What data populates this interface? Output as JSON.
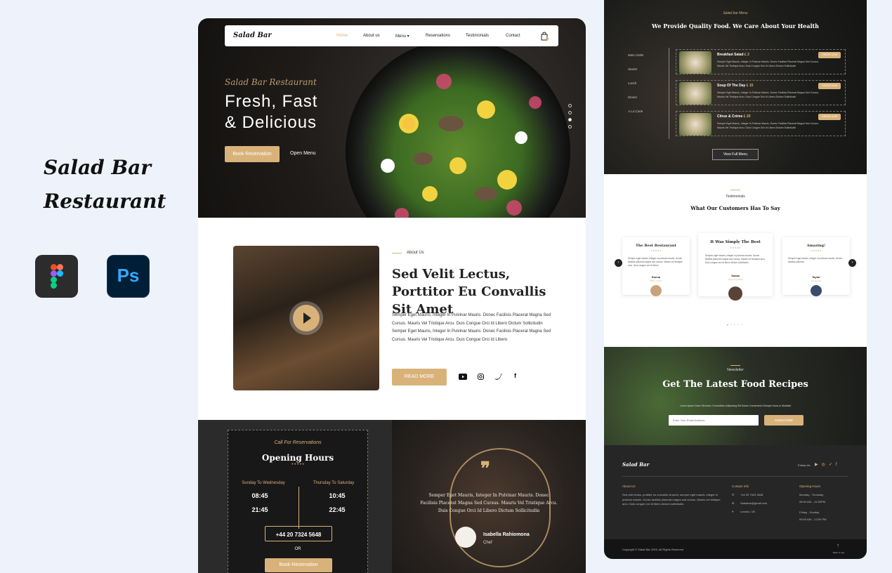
{
  "promo": {
    "title_line1": "Salad Bar",
    "title_line2": "Restaurant",
    "figma_icon": "figma-logo",
    "ps_label": "Ps"
  },
  "nav": {
    "logo": "Salad Bar",
    "items": [
      "Home",
      "About us",
      "Menu ▾",
      "Reservations",
      "Testimonials",
      "Contact"
    ],
    "active": "Home",
    "cart_icon": "bag-icon"
  },
  "hero": {
    "subtitle": "Salad Bar Restaurant",
    "title_line1": "Fresh, Fast",
    "title_line2": "& Delicious",
    "btn_book": "Book Reservation",
    "btn_menu": "Open Menu"
  },
  "about": {
    "label": "About Us",
    "heading": "Sed Velit Lectus, Porttitor Eu Convallis Sit Amet",
    "body": "Semper Eget Mauris, Integer In Pulvinar Mauris. Donec Facilisis Placerat Magna Sed Cursus. Mauris Vel Tristique Arcu. Duis Congue Orci Id Libero Dictum Sollicitudin Semper Eget Mauris, Integer In Pulvinar Mauris. Donec Facilisis Placerat Magna Sed Cursus. Mauris Vel Tristique Arcu. Duis Congue Orci Id Libero",
    "btn": "READ MORE",
    "social": [
      "youtube-icon",
      "instagram-icon",
      "twitter-icon",
      "facebook-icon"
    ]
  },
  "hours": {
    "label": "Call For Reservations",
    "title": "Opening Hours",
    "col1_head": "Sunday To Wednesday",
    "col1_open": "08:45",
    "col1_close": "21:45",
    "col2_head": "Thursday To Saturday",
    "col2_open": "10:45",
    "col2_close": "22:45",
    "phone": "+44 20 7324 5648",
    "or": "OR",
    "btn": "Book Reservation"
  },
  "chef": {
    "quote": "Semper Eget Mauris, Integer In Pulvinar Mauris. Donec Facilisis Placerat Magna Sed Cursus. Mauris Vel Tristique Arcu. Duis Congue Orci Id Libero Dictum Sollicitudin",
    "name": "Isabella Rahiomona",
    "role": "Chef"
  },
  "menu": {
    "label": "Salad bar Menu",
    "heading": "We Provide Quality Food. We Care About Your Health",
    "tabs": [
      "Main Order",
      "Starter",
      "Lunch",
      "Dinner",
      "A La Carte"
    ],
    "items": [
      {
        "name": "Breakfast Salad",
        "price": "£ 2",
        "desc": "Semper Eget Mauris, Integer In Pulvinar Mauris. Donec Facilisis Placerat Magna Sed Cursus. Mauris Vel Tristique Arcu. Duis Congue Orci Id Libero Dictum Sollicitudin",
        "btn": "ORDER NOW"
      },
      {
        "name": "Soup Of The Day",
        "price": "£ 15",
        "desc": "Semper Eget Mauris, Integer In Pulvinar Mauris. Donec Facilisis Placerat Magna Sed Cursus. Mauris Vel Tristique Arcu. Duis Congue Orci Id Libero Dictum Sollicitudin",
        "btn": "ORDER NOW"
      },
      {
        "name": "Citrus & Crème",
        "price": "£ 20",
        "desc": "Semper Eget Mauris, Integer In Pulvinar Mauris. Donec Facilisis Placerat Magna Sed Cursus. Mauris Vel Tristique Arcu. Duis Congue Orci Id Libero Dictum Sollicitudin",
        "btn": "ORDER NOW"
      }
    ],
    "btn": "View Full Menu"
  },
  "testimonials": {
    "label": "Testimonials",
    "heading": "What Our Customers Has To Say",
    "cards": [
      {
        "title": "The Best Restaurant",
        "text": "Semper eget mauris, integer in pulvinar mauris. Donec facilisis placerat magna sed cursus. Mauris vel tristique arcu. Duis congue orci id libero",
        "name": "Emma",
        "role": "Office worker"
      },
      {
        "title": "It Was Simply The Best",
        "text": "Semper eget mauris, integer in pulvinar mauris. Donec facilisis placerat magna sed cursus. Mauris vel tristique arcu. Duis congue orci id libero dictum sollicitudin",
        "name": "Sanaa",
        "role": "Shopping Addict"
      },
      {
        "title": "Amazing!",
        "text": "Semper eget mauris, integer in pulvinar mauris. Donec facilisis placerat",
        "name": "Taylor",
        "role": "Food Critic"
      }
    ],
    "rating": "★★★★★"
  },
  "newsletter": {
    "label": "Newsletter",
    "heading": "Get The Latest Food Recipes",
    "sub": "Lorem Ipsum Dolor Sit Amet, Consectetur Adipiscing Elit Donec Consectetur Semper Nunc In Molestie",
    "placeholder": "Enter Your Email Address",
    "btn": "SUBSCRIBE"
  },
  "footer": {
    "logo": "Salad Bar",
    "follow": "Follow Us",
    "about_head": "About Us",
    "about_text": "Sed velit lectus, porttitor eu convallis sit amet, semper eget mauris, integer in pulvinar mauris. Donec facilisis placerat magna sed cursus. Mauris vel tristique arcu. Duis congue orci id libero dictum sollicitudin.",
    "contact_head": "Contact Info",
    "phone": "+44 20 7324 5648",
    "email": "Saladbar@gmail.com",
    "address": "London, UK",
    "hours_head": "Opening Hours",
    "hours1": "Monday - Thursday",
    "hours1_time": "08:00 AM – 11:00PM",
    "hours2": "Friday - Sunday",
    "hours2_time": "09:00 AM – 12:00 PM",
    "copyright": "Copyright © Salad Bar 2023. All Rights Reserved",
    "back_top": "Back To Top"
  },
  "colors": {
    "accent": "#d9b27a",
    "dark": "#1c1c1c",
    "bg": "#eef3fb"
  }
}
